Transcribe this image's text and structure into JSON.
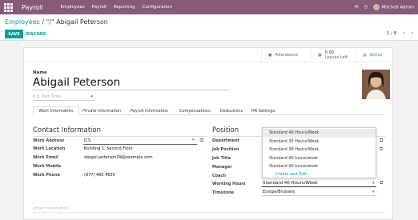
{
  "topbar": {
    "app_title": "Payroll",
    "menu": [
      "Employees",
      "Payroll",
      "Reporting",
      "Configuration"
    ],
    "user": "Mitchell Admin",
    "brand_color": "#875a7b"
  },
  "control": {
    "breadcrumb_link": "Employees",
    "breadcrumb_sep": "/",
    "breadcrumb_current": "\"/\" Abigail Peterson",
    "save_label": "SAVE",
    "discard_label": "DISCARD",
    "pager": "1 / 8"
  },
  "smart_buttons": {
    "attendance": "Attendance",
    "leaves_value": "0.00",
    "leaves_label": "Leaves Left",
    "status": "Active"
  },
  "employee": {
    "name_label": "Name",
    "name": "Abigail Peterson",
    "job_title_placeholder": "e.g. Part Time"
  },
  "tabs": [
    "Work Information",
    "Private Information",
    "Payroll Information",
    "Compensations",
    "Deductions",
    "HR Settings"
  ],
  "contact": {
    "title": "Contact Information",
    "fields": [
      {
        "label": "Work Address",
        "value": "ICS"
      },
      {
        "label": "Work Location",
        "value": "Building 1, Second Floor"
      },
      {
        "label": "Work Email",
        "value": "abigail.peterson39@example.com"
      },
      {
        "label": "Work Mobile",
        "value": ""
      },
      {
        "label": "Work Phone",
        "value": "(877) 465 4635"
      }
    ]
  },
  "position": {
    "title": "Position",
    "fields": [
      {
        "label": "Department",
        "value": ""
      },
      {
        "label": "Job Position",
        "value": ""
      },
      {
        "label": "Job Title",
        "value": ""
      },
      {
        "label": "Manager",
        "value": ""
      },
      {
        "label": "Coach",
        "value": ""
      },
      {
        "label": "Working Hours",
        "value": "Standard 40 Hours/Week"
      },
      {
        "label": "Timezone",
        "value": "Europe/Brussels"
      }
    ]
  },
  "dropdown": {
    "options": [
      "Standard 40 Hours/Week",
      "Standard 35 Hours/Week",
      "Standard 38 Hours/Week",
      "Standard 40 hours/week",
      "Standard 40 hours/week"
    ],
    "create_label": "Create and Edit..."
  },
  "other_info_placeholder": "Other Information ..."
}
